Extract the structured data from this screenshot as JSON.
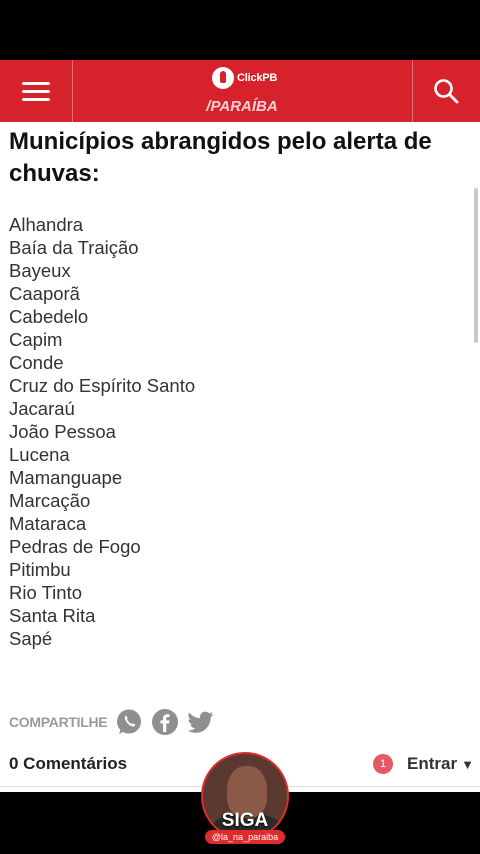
{
  "header": {
    "logo_text": "ClickPB",
    "section": "/PARAÍBA",
    "color": "#d8222b"
  },
  "article": {
    "heading": "Municípios abrangidos pelo alerta de chuvas:",
    "cities": [
      "Alhandra",
      "Baía da Traição",
      "Bayeux",
      "Caaporã",
      "Cabedelo",
      "Capim",
      "Conde",
      "Cruz do Espírito Santo",
      "Jacaraú",
      "João Pessoa",
      "Lucena",
      "Mamanguape",
      "Marcação",
      "Mataraca",
      "Pedras de Fogo",
      "Pitimbu",
      "Rio Tinto",
      "Santa Rita",
      "Sapé"
    ]
  },
  "share": {
    "label": "COMPARTILHE",
    "icons": [
      "whatsapp-icon",
      "facebook-icon",
      "twitter-icon"
    ]
  },
  "comments": {
    "count_label": "0 Comentários",
    "notification_count": "1",
    "login_label": "Entrar"
  },
  "overlay": {
    "cta": "SIGA",
    "handle": "@la_na_paraiba"
  }
}
